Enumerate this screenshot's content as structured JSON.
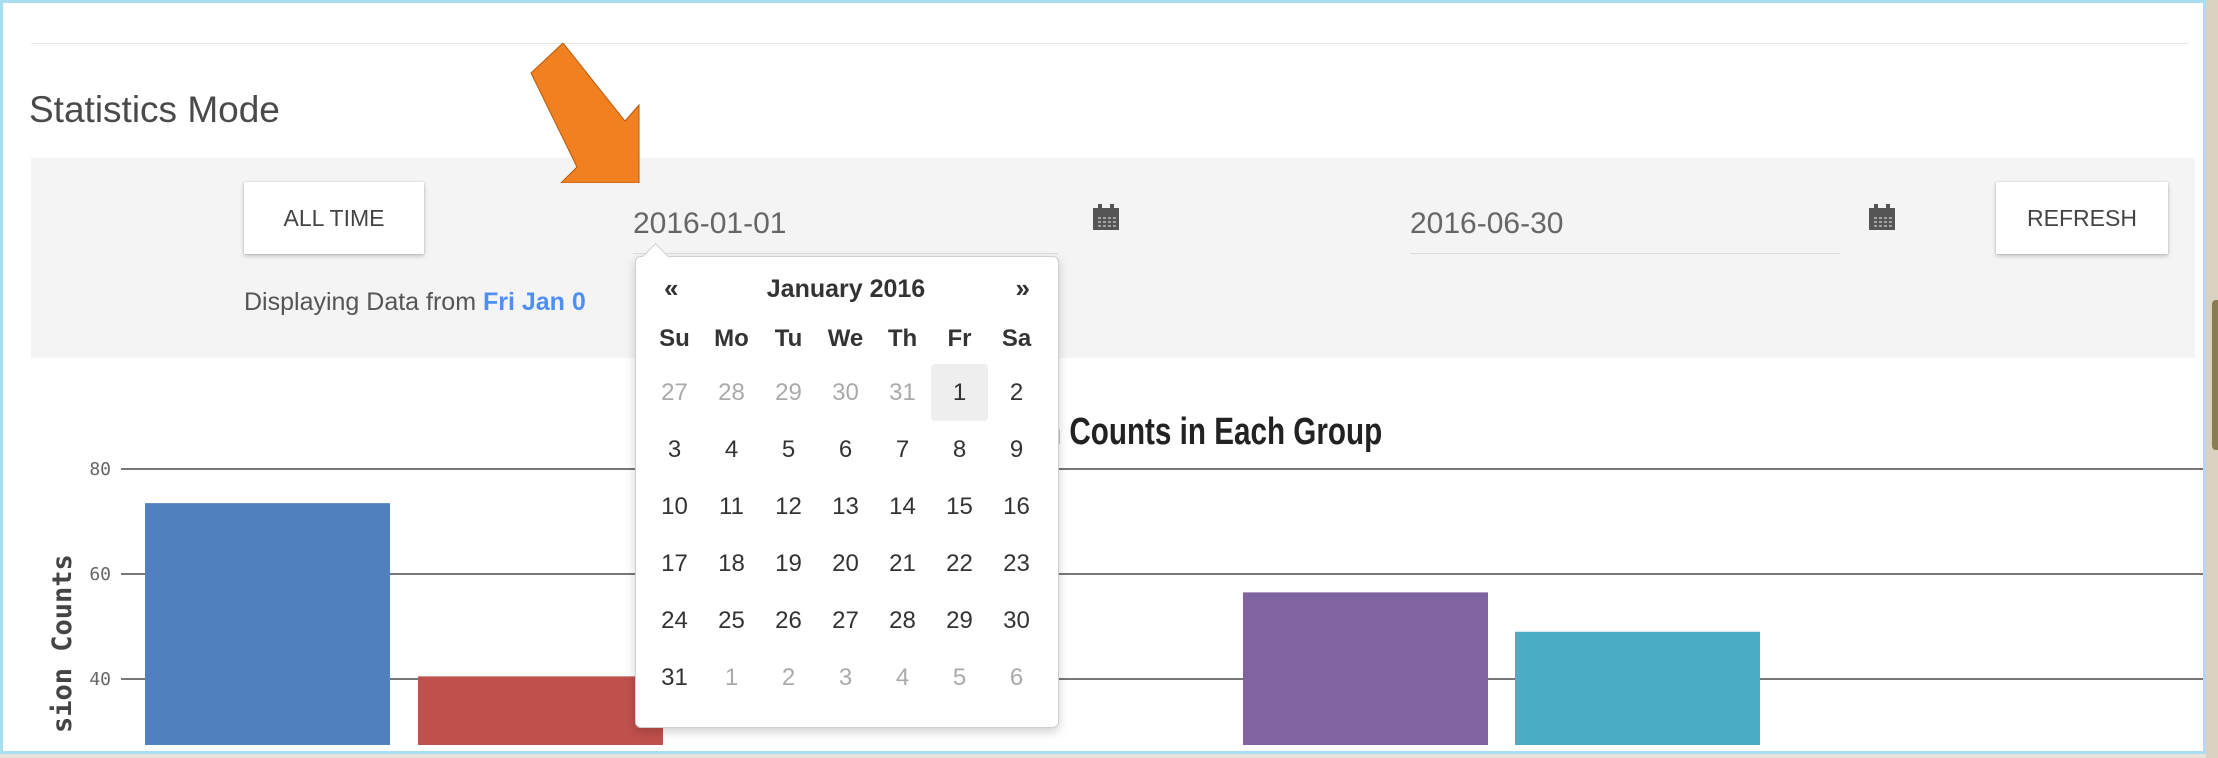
{
  "header": {
    "section_title": "Statistics Mode"
  },
  "controls": {
    "all_time_label": "ALL TIME",
    "refresh_label": "REFRESH",
    "start_date_value": "2016-01-01",
    "end_date_value": "2016-06-30",
    "calendar_icon": "calendar-icon",
    "display_prefix": "Displaying Data from ",
    "display_date": "Fri Jan 0"
  },
  "datepicker": {
    "prev_label": "«",
    "next_label": "»",
    "month_title": "January 2016",
    "weekdays": [
      "Su",
      "Mo",
      "Tu",
      "We",
      "Th",
      "Fr",
      "Sa"
    ],
    "weeks": [
      [
        {
          "d": "27",
          "m": true
        },
        {
          "d": "28",
          "m": true
        },
        {
          "d": "29",
          "m": true
        },
        {
          "d": "30",
          "m": true
        },
        {
          "d": "31",
          "m": true
        },
        {
          "d": "1",
          "a": true
        },
        {
          "d": "2"
        }
      ],
      [
        {
          "d": "3"
        },
        {
          "d": "4"
        },
        {
          "d": "5"
        },
        {
          "d": "6"
        },
        {
          "d": "7"
        },
        {
          "d": "8"
        },
        {
          "d": "9"
        }
      ],
      [
        {
          "d": "10"
        },
        {
          "d": "11"
        },
        {
          "d": "12"
        },
        {
          "d": "13"
        },
        {
          "d": "14"
        },
        {
          "d": "15"
        },
        {
          "d": "16"
        }
      ],
      [
        {
          "d": "17"
        },
        {
          "d": "18"
        },
        {
          "d": "19"
        },
        {
          "d": "20"
        },
        {
          "d": "21"
        },
        {
          "d": "22"
        },
        {
          "d": "23"
        }
      ],
      [
        {
          "d": "24"
        },
        {
          "d": "25"
        },
        {
          "d": "26"
        },
        {
          "d": "27"
        },
        {
          "d": "28"
        },
        {
          "d": "29"
        },
        {
          "d": "30"
        }
      ],
      [
        {
          "d": "31"
        },
        {
          "d": "1",
          "m": true
        },
        {
          "d": "2",
          "m": true
        },
        {
          "d": "3",
          "m": true
        },
        {
          "d": "4",
          "m": true
        },
        {
          "d": "5",
          "m": true
        },
        {
          "d": "6",
          "m": true
        }
      ]
    ]
  },
  "chart_data": {
    "type": "bar",
    "title": "n Counts in Each Group",
    "ylabel": "sion Counts",
    "yticks": [
      "40",
      "60",
      "80"
    ],
    "ylim": [
      30,
      80
    ],
    "bars": [
      {
        "value": 73.5,
        "color": "#5081be"
      },
      {
        "value": 40.5,
        "color": "#c0504d"
      },
      {
        "value": 56.5,
        "color": "#8064a2"
      },
      {
        "value": 49,
        "color": "#4bacc6"
      }
    ],
    "grid": true
  },
  "annotation": {
    "arrow_color": "#f08020"
  }
}
